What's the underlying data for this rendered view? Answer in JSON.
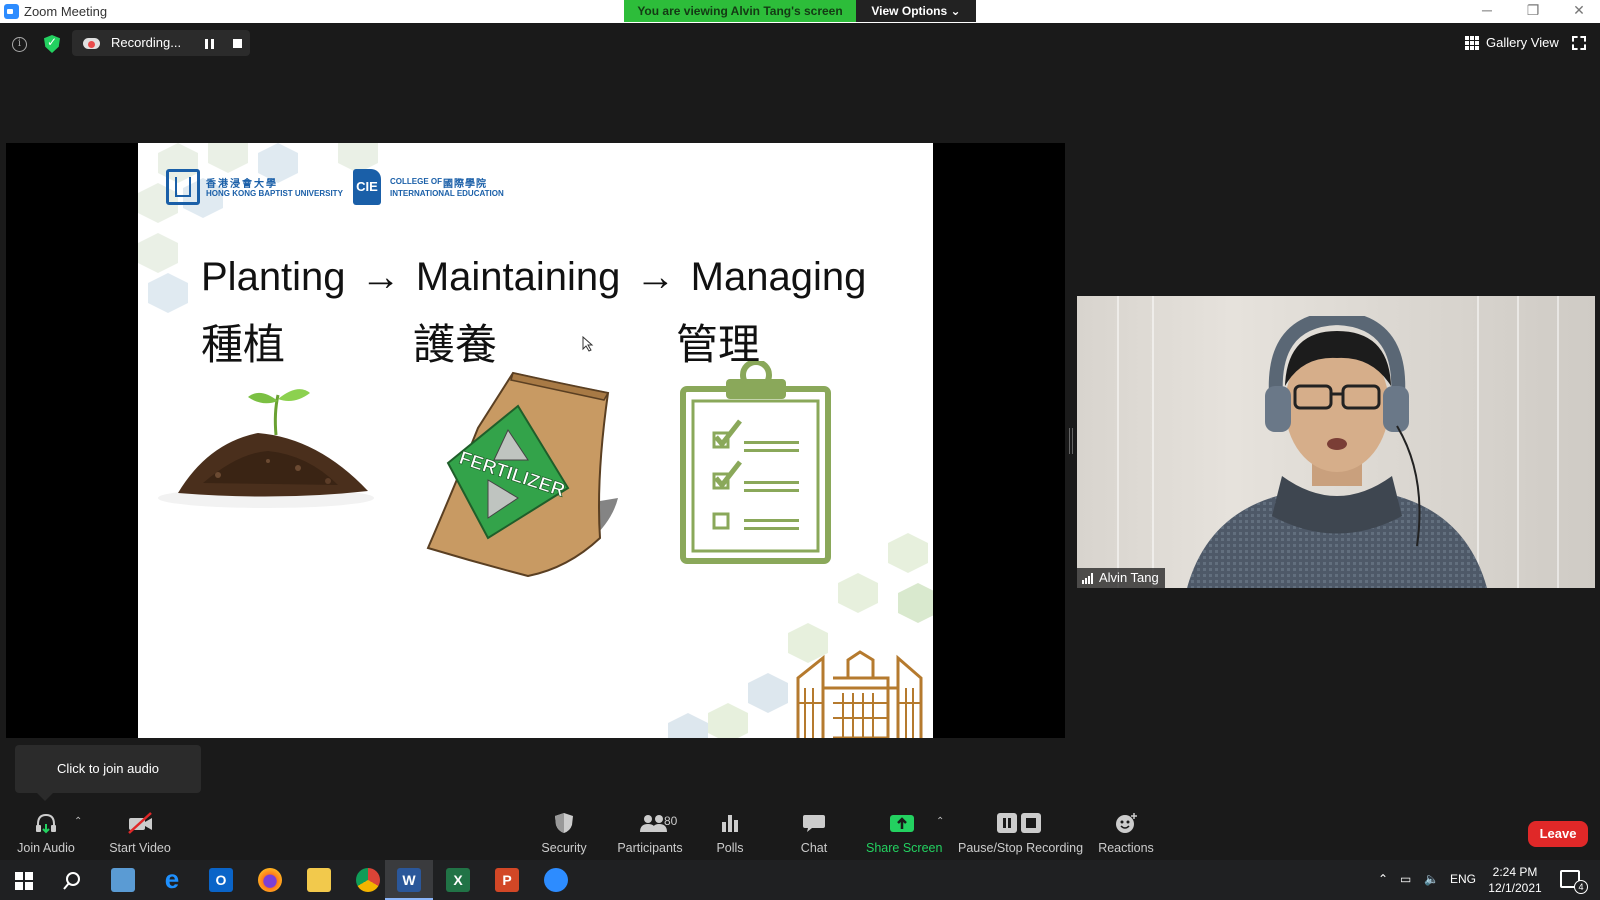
{
  "window": {
    "title": "Zoom Meeting",
    "banner": "You are viewing Alvin Tang's screen",
    "view_options": "View Options",
    "minimize": "─",
    "restore": "❐",
    "close": "✕"
  },
  "topbar": {
    "recording_label": "Recording...",
    "gallery_view_label": "Gallery View"
  },
  "slide": {
    "university_cn": "香港浸會大學",
    "university_en": "HONG KONG BAPTIST UNIVERSITY",
    "college_abbr": "CIE",
    "college_cn": "國際學院",
    "college_en_1": "COLLEGE OF",
    "college_en_2": "INTERNATIONAL EDUCATION",
    "title_1": "Planting",
    "arrow": "→",
    "title_2": "Maintaining",
    "title_3": "Managing",
    "cn_1": "種植",
    "cn_2": "護養",
    "cn_3": "管理",
    "bag_text": "FERTILIZER"
  },
  "participant": {
    "name": "Alvin Tang"
  },
  "tooltip": "Click to join audio",
  "toolbar": {
    "join_audio": "Join Audio",
    "start_video": "Start Video",
    "security": "Security",
    "participants": "Participants",
    "participants_count": "80",
    "polls": "Polls",
    "chat": "Chat",
    "share_screen": "Share Screen",
    "pause_stop_recording": "Pause/Stop Recording",
    "reactions": "Reactions",
    "leave": "Leave"
  },
  "taskbar": {
    "language": "ENG",
    "time": "2:24 PM",
    "date": "12/1/2021",
    "notification_count": "4"
  },
  "colors": {
    "accent_green": "#2dbd3a",
    "leave_red": "#e02828",
    "zoom_blue": "#2D8CFF",
    "hkbu_blue": "#1a5fa8",
    "icon_green": "#8aa85a",
    "bag_tan": "#c89a63"
  }
}
